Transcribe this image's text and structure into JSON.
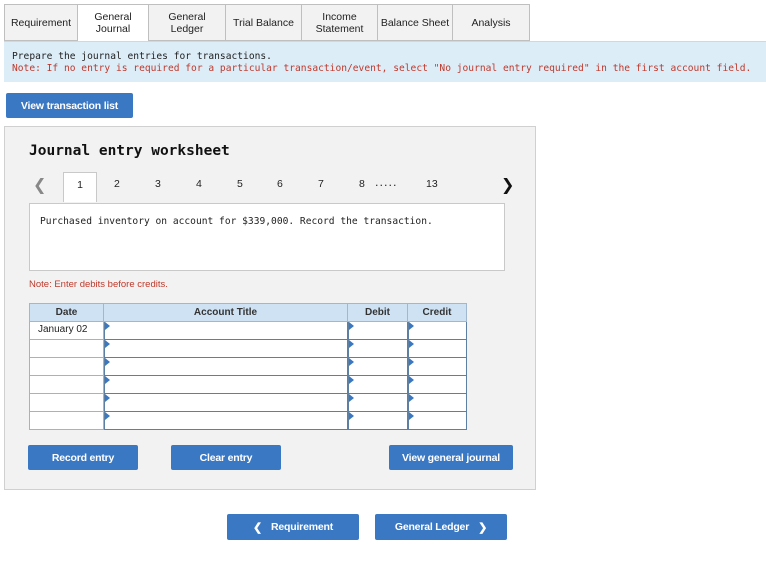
{
  "tabs": [
    {
      "label": "Requirement"
    },
    {
      "label": "General\nJournal",
      "active": true
    },
    {
      "label": "General\nLedger"
    },
    {
      "label": "Trial Balance"
    },
    {
      "label": "Income\nStatement"
    },
    {
      "label": "Balance Sheet"
    },
    {
      "label": "Analysis"
    }
  ],
  "instructions": {
    "line1": "Prepare the journal entries for transactions.",
    "line2": "Note: If no entry is required for a particular transaction/event, select \"No journal entry required\" in the first account field."
  },
  "view_transaction_list_label": "View transaction list",
  "worksheet": {
    "title": "Journal entry worksheet",
    "pages": [
      "1",
      "2",
      "3",
      "4",
      "5",
      "6",
      "7",
      "8"
    ],
    "dots": ".....",
    "last_page": "13",
    "active_page": "1",
    "transaction_text": "Purchased inventory on account for $339,000. Record the transaction.",
    "note": "Note: Enter debits before credits.",
    "columns": {
      "date": "Date",
      "account": "Account Title",
      "debit": "Debit",
      "credit": "Credit"
    },
    "rows": [
      {
        "date": "January 02",
        "account": "",
        "debit": "",
        "credit": ""
      },
      {
        "date": "",
        "account": "",
        "debit": "",
        "credit": ""
      },
      {
        "date": "",
        "account": "",
        "debit": "",
        "credit": ""
      },
      {
        "date": "",
        "account": "",
        "debit": "",
        "credit": ""
      },
      {
        "date": "",
        "account": "",
        "debit": "",
        "credit": ""
      },
      {
        "date": "",
        "account": "",
        "debit": "",
        "credit": ""
      }
    ],
    "buttons": {
      "record": "Record entry",
      "clear": "Clear entry",
      "view_journal": "View general journal"
    }
  },
  "nav": {
    "prev_label": "Requirement",
    "next_label": "General Ledger"
  },
  "colors": {
    "accent": "#3a78c3",
    "banner": "#dcedf8",
    "warning": "#c0392b",
    "header": "#cfe2f3"
  }
}
